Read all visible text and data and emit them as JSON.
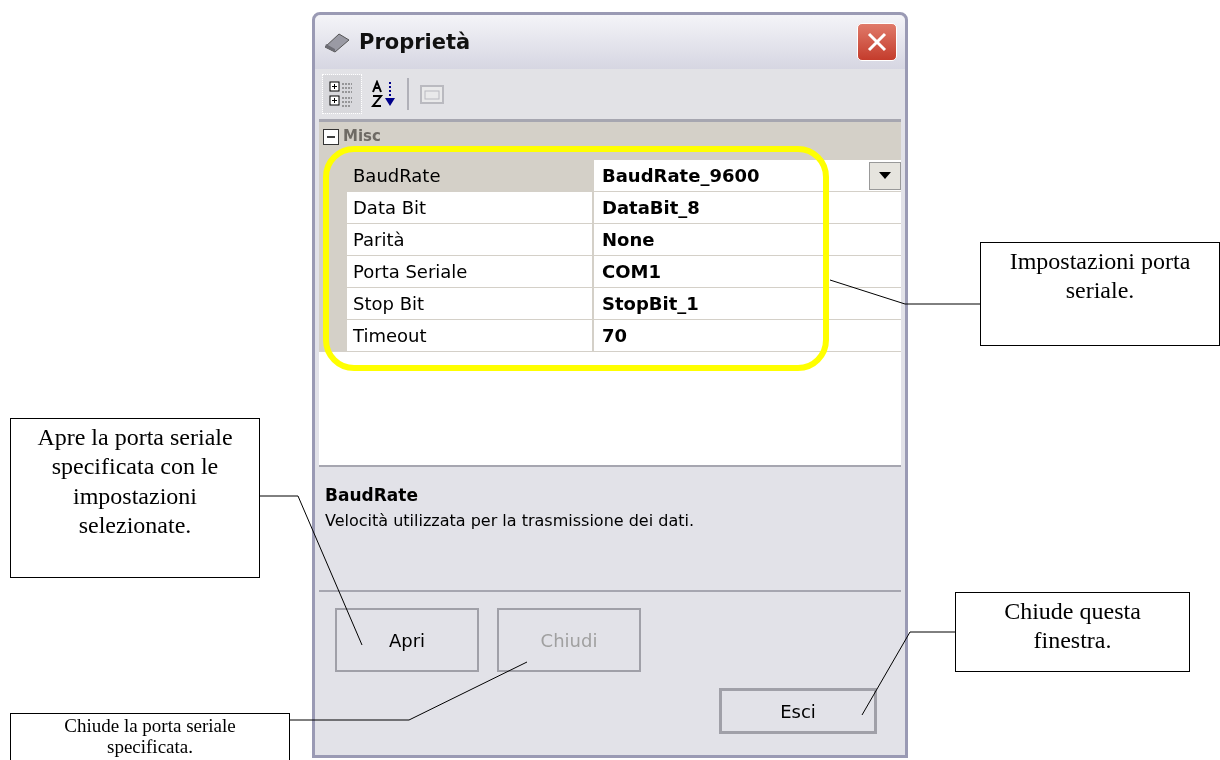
{
  "window": {
    "title": "Proprietà"
  },
  "toolbar": [
    {
      "kind": "categorized",
      "selected": true,
      "disabled": false
    },
    {
      "kind": "alphabetical",
      "selected": false,
      "disabled": false
    },
    {
      "kind": "property-pages",
      "selected": false,
      "disabled": true
    }
  ],
  "grid": {
    "category": {
      "name": "Misc",
      "expanded": true
    },
    "properties": [
      {
        "name": "BaudRate",
        "value": "BaudRate_9600",
        "selected": true
      },
      {
        "name": "Data Bit",
        "value": "DataBit_8",
        "selected": false
      },
      {
        "name": "Parità",
        "value": "None",
        "selected": false
      },
      {
        "name": "Porta Seriale",
        "value": "COM1",
        "selected": false
      },
      {
        "name": "Stop Bit",
        "value": "StopBit_1",
        "selected": false
      },
      {
        "name": "Timeout",
        "value": "70",
        "selected": false
      }
    ]
  },
  "description": {
    "title": "BaudRate",
    "text": "Velocità utilizzata per la trasmissione dei dati."
  },
  "buttons": [
    {
      "label": "Apri",
      "disabled": false
    },
    {
      "label": "Chiudi",
      "disabled": true
    },
    {
      "label": "Esci",
      "disabled": false
    }
  ],
  "callouts": [
    {
      "text": "Impostazioni porta seriale."
    },
    {
      "text": "Apre la porta seriale specificata con le impostazioni selezionate."
    },
    {
      "text": "Chiude la porta seriale specificata."
    },
    {
      "text": "Chiude questa finestra."
    }
  ]
}
